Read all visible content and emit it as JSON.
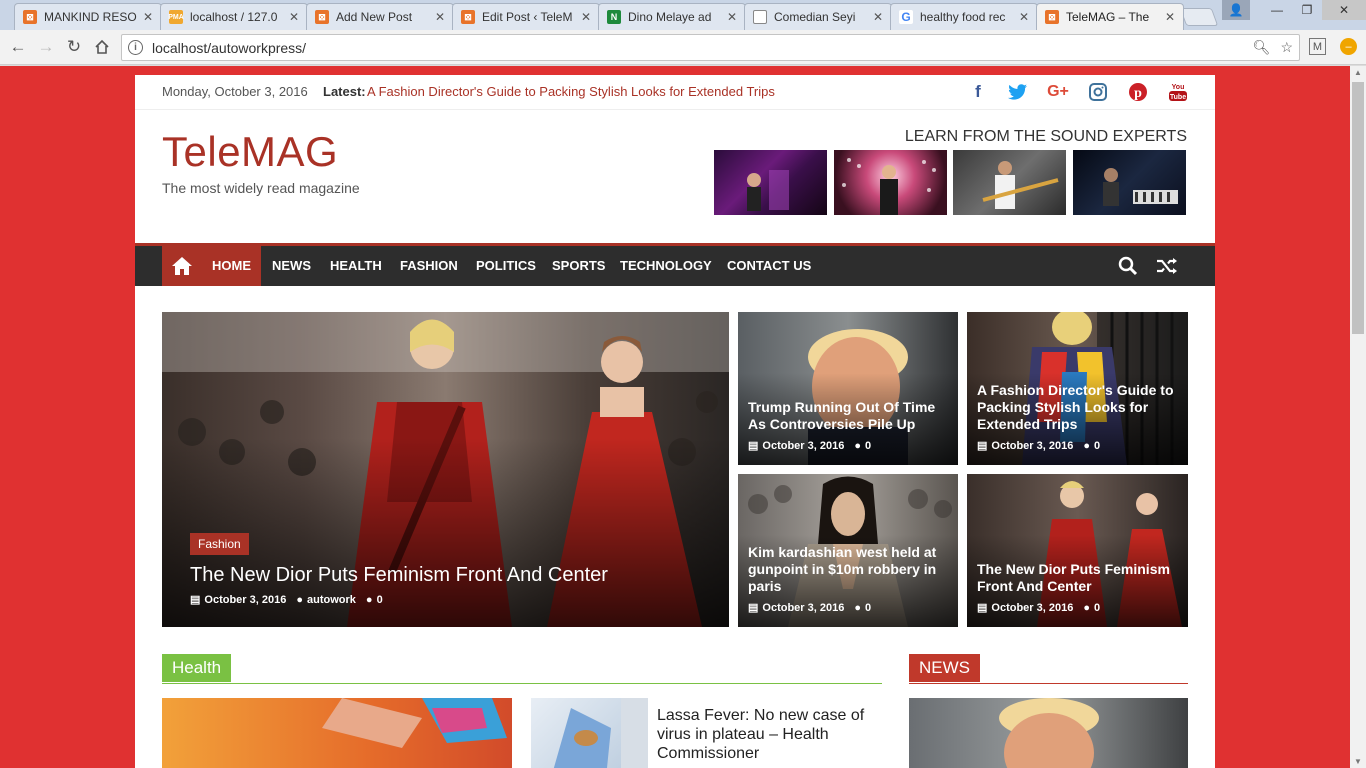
{
  "browser": {
    "tabs": [
      {
        "title": "MANKIND RESO",
        "favicon_color": "#e8732a",
        "favicon": "box-icon"
      },
      {
        "title": "localhost / 127.0",
        "favicon_color": "#f0a830",
        "favicon": "pma-icon"
      },
      {
        "title": "Add New Post",
        "favicon_color": "#e8732a",
        "favicon": "box-icon"
      },
      {
        "title": "Edit Post ‹ TeleM",
        "favicon_color": "#e8732a",
        "favicon": "box-icon"
      },
      {
        "title": "Dino Melaye ad",
        "favicon_color": "#1e8a3c",
        "favicon": "n-icon"
      },
      {
        "title": "Comedian Seyi",
        "favicon_color": "#888888",
        "favicon": "doc-icon"
      },
      {
        "title": "healthy food rec",
        "favicon_color": "#4285f4",
        "favicon": "google-icon"
      },
      {
        "title": "TeleMAG – The",
        "favicon_color": "#e8732a",
        "favicon": "box-icon",
        "active": true
      }
    ],
    "url": "localhost/autoworkpress/"
  },
  "colors": {
    "accent": "#a93226",
    "page_bg": "#e03131",
    "menu_bg": "#2d2d2d",
    "health": "#7ac143",
    "news": "#c0392b"
  },
  "topbar": {
    "date": "Monday, October 3, 2016",
    "latest_label": "Latest:",
    "latest_link": "A Fashion Director's Guide to Packing Stylish Looks for Extended Trips",
    "socials": [
      "facebook-icon",
      "twitter-icon",
      "google-plus-icon",
      "instagram-icon",
      "pinterest-icon",
      "youtube-icon"
    ]
  },
  "header": {
    "logo": "TeleMAG",
    "tagline": "The most widely read magazine",
    "promo_title": "LEARN FROM THE SOUND EXPERTS"
  },
  "menu": {
    "items": [
      "HOME",
      "NEWS",
      "HEALTH",
      "FASHION",
      "POLITICS",
      "SPORTS",
      "TECHNOLOGY",
      "CONTACT US"
    ]
  },
  "featured": {
    "main": {
      "category": "Fashion",
      "title": "The New Dior Puts Feminism Front And Center",
      "date": "October 3, 2016",
      "author": "autowork",
      "comments": "0"
    },
    "grid": [
      {
        "title": "Trump Running Out Of Time As Controversies Pile Up",
        "date": "October 3, 2016",
        "comments": "0"
      },
      {
        "title": "A Fashion Director's Guide to Packing Stylish Looks for Extended Trips",
        "date": "October 3, 2016",
        "comments": "0"
      },
      {
        "title": "Kim kardashian west held at gunpoint in $10m robbery in paris",
        "date": "October 3, 2016",
        "comments": "0"
      },
      {
        "title": "The New Dior Puts Feminism Front And Center",
        "date": "October 3, 2016",
        "comments": "0"
      }
    ]
  },
  "health": {
    "heading": "Health",
    "side_title": "Lassa Fever: No new case of virus in plateau – Health Commissioner"
  },
  "news": {
    "heading": "NEWS"
  }
}
